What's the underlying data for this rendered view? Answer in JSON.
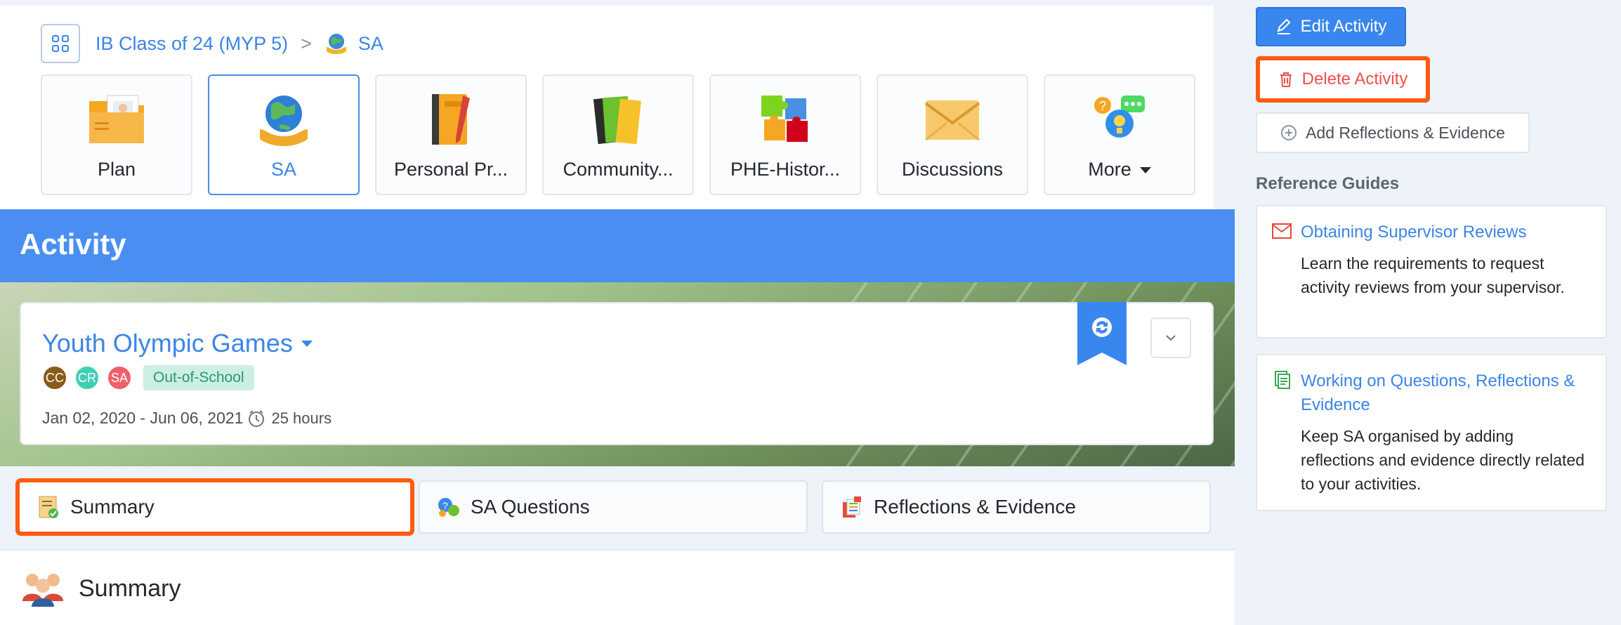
{
  "breadcrumb": {
    "parent": "IB Class of 24 (MYP 5)",
    "separator": ">",
    "current": "SA"
  },
  "nav_tiles": [
    {
      "label": "Plan",
      "icon": "folder-person-icon"
    },
    {
      "label": "SA",
      "icon": "globe-hands-icon",
      "active": true
    },
    {
      "label": "Personal Pr...",
      "icon": "notebook-pen-icon"
    },
    {
      "label": "Community...",
      "icon": "books-icon"
    },
    {
      "label": "PHE-Histor...",
      "icon": "puzzle-icon"
    },
    {
      "label": "Discussions",
      "icon": "envelope-icon"
    },
    {
      "label": "More",
      "icon": "question-bubble-icon"
    }
  ],
  "banner": {
    "title": "Activity"
  },
  "activity": {
    "title": "Youth Olympic Games",
    "members": [
      {
        "initials": "CC",
        "color": "#8a5a1a"
      },
      {
        "initials": "CR",
        "color": "#3fd0b4"
      },
      {
        "initials": "SA",
        "color": "#f0606a"
      }
    ],
    "tag": "Out-of-School",
    "dates": "Jan 02, 2020 - Jun 06, 2021",
    "hours": "25 hours"
  },
  "section_tabs": [
    {
      "label": "Summary",
      "icon": "checklist-icon"
    },
    {
      "label": "SA Questions",
      "icon": "question-chat-icon"
    },
    {
      "label": "Reflections & Evidence",
      "icon": "documents-icon"
    }
  ],
  "summary": {
    "heading": "Summary"
  },
  "actions": {
    "edit": "Edit Activity",
    "delete": "Delete Activity",
    "add": "Add Reflections & Evidence"
  },
  "reference": {
    "heading": "Reference Guides",
    "guides": [
      {
        "title": "Obtaining Supervisor Reviews",
        "desc": "Learn the requirements to request activity reviews from your supervisor."
      },
      {
        "title": "Working on Questions, Reflections & Evidence",
        "desc": "Keep SA organised by adding reflections and evidence directly related to your activities."
      }
    ]
  },
  "colors": {
    "accent": "#3c84e8",
    "banner": "#4a8ef2",
    "highlight": "#ff5a12",
    "danger": "#f04e4e"
  }
}
